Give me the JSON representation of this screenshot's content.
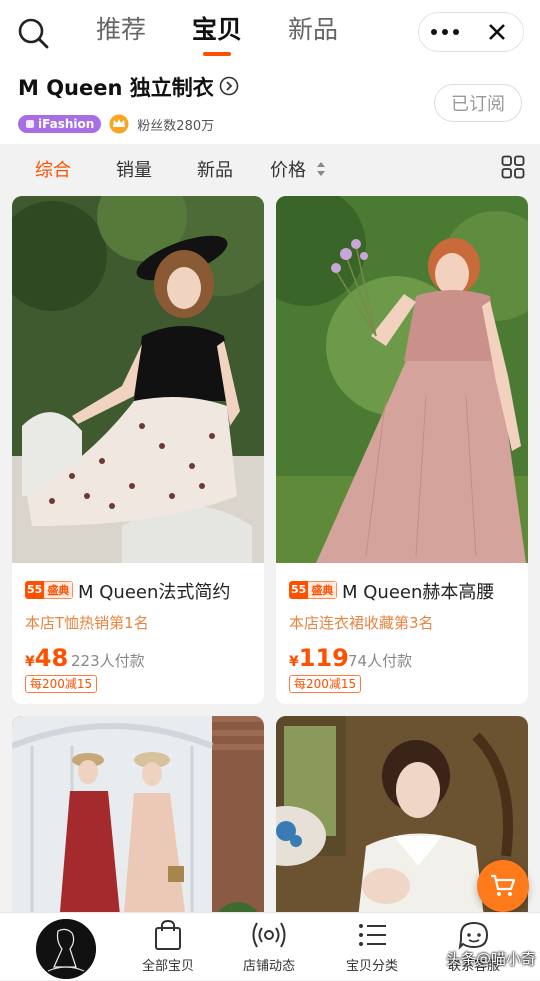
{
  "topbar": {
    "tabs": [
      {
        "label": "推荐",
        "active": false
      },
      {
        "label": "宝贝",
        "active": true
      },
      {
        "label": "新品",
        "active": false
      }
    ],
    "icons": [
      "search-icon",
      "more-icon",
      "close-icon"
    ]
  },
  "shop": {
    "name": "M Queen 独立制衣",
    "ifashion_label": "iFashion",
    "fans": "粉丝数280万",
    "subscribe_label": "已订阅"
  },
  "sort": {
    "items": [
      "综合",
      "销量",
      "新品",
      "价格"
    ],
    "active": "综合"
  },
  "products": [
    {
      "badge_num": "55",
      "badge_text": "盛典",
      "title": "M Queen法式简约",
      "rank": "本店T恤热销第1名",
      "currency": "¥",
      "price": "48",
      "sold": "223人付款",
      "promo": "每200减15"
    },
    {
      "badge_num": "55",
      "badge_text": "盛典",
      "title": "M Queen赫本高腰",
      "rank": "本店连衣裙收藏第3名",
      "currency": "¥",
      "price": "119",
      "sold": "74人付款",
      "promo": "每200减15"
    }
  ],
  "bottomnav": {
    "items": [
      {
        "label": "全部宝贝",
        "icon": "bag-icon"
      },
      {
        "label": "店铺动态",
        "icon": "broadcast-icon"
      },
      {
        "label": "宝贝分类",
        "icon": "list-icon"
      },
      {
        "label": "联系客服",
        "icon": "chat-icon"
      }
    ]
  },
  "watermark": "头条@喵小奇",
  "colors": {
    "accent": "#ff5000",
    "rank": "#e98540",
    "ifashion": "#a76ee6",
    "cart": "#ff7a1a"
  }
}
